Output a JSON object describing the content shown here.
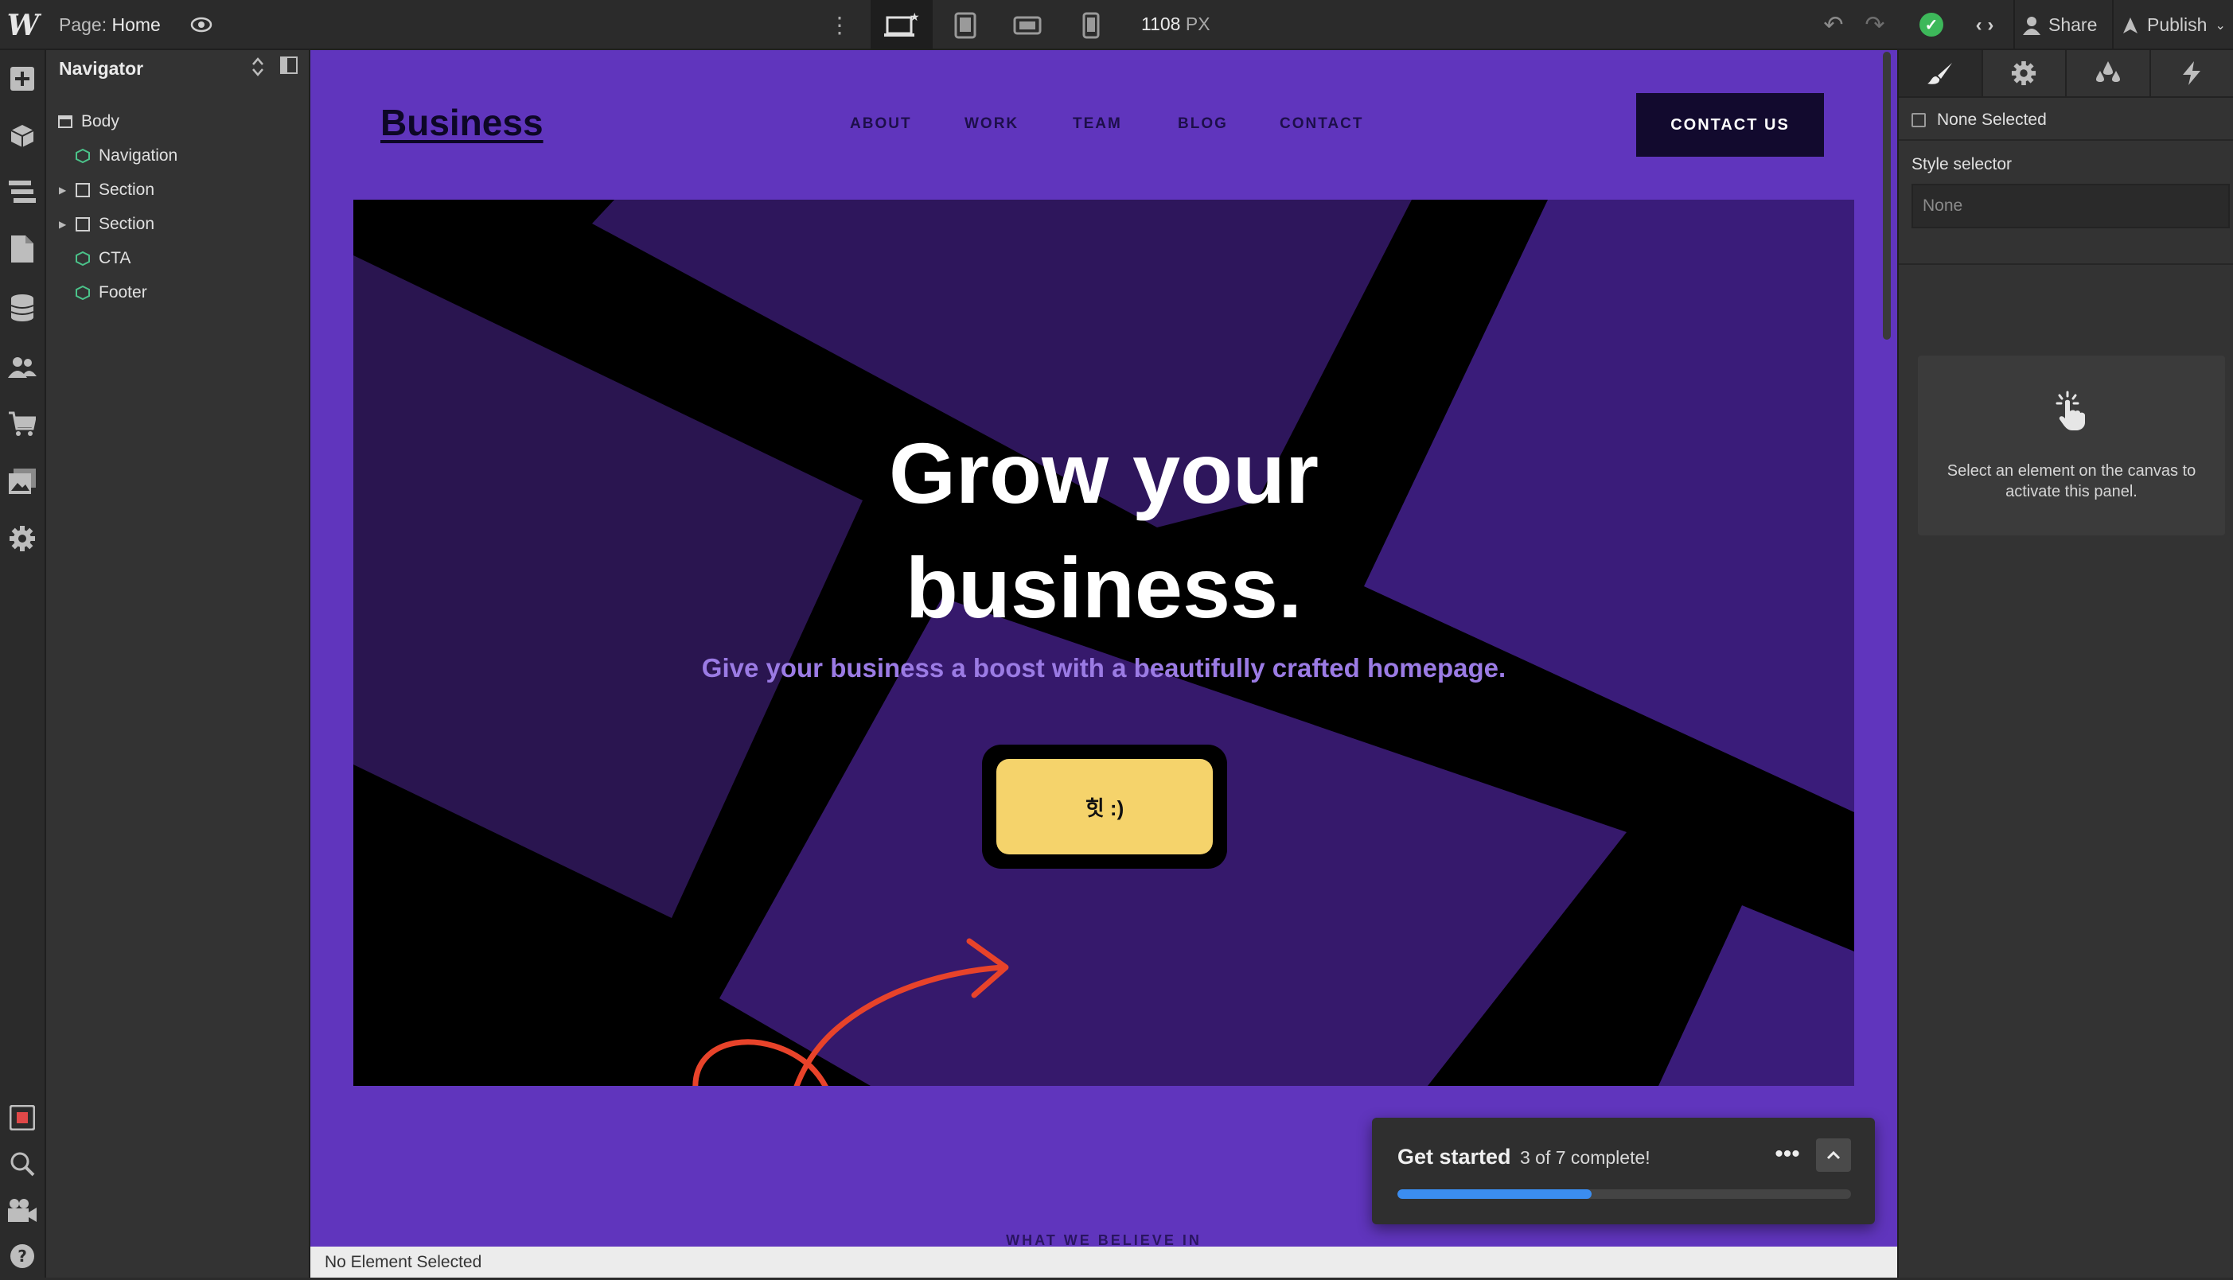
{
  "topbar": {
    "logo": "W",
    "page_prefix": "Page:",
    "page_name": "Home",
    "width_value": "1108",
    "width_unit": "PX",
    "share_label": "Share",
    "publish_label": "Publish"
  },
  "navigator": {
    "title": "Navigator",
    "items": [
      {
        "label": "Body",
        "icon": "body-icon",
        "expandable": false
      },
      {
        "label": "Navigation",
        "icon": "component-icon",
        "expandable": false
      },
      {
        "label": "Section",
        "icon": "section-icon",
        "expandable": true
      },
      {
        "label": "Section",
        "icon": "section-icon",
        "expandable": true
      },
      {
        "label": "CTA",
        "icon": "component-icon",
        "expandable": false
      },
      {
        "label": "Footer",
        "icon": "component-icon",
        "expandable": false
      }
    ]
  },
  "site": {
    "brand": "Business",
    "nav": [
      "ABOUT",
      "WORK",
      "TEAM",
      "BLOG",
      "CONTACT"
    ],
    "cta": "CONTACT US",
    "hero_title_1": "Grow your",
    "hero_title_2": "business.",
    "hero_subtitle": "Give your business a boost with a beautifully crafted homepage.",
    "hero_button": "힛 :)",
    "next_section_label": "WHAT WE BELIEVE IN"
  },
  "get_started": {
    "title": "Get started",
    "progress_text": "3 of 7 complete!",
    "completed": 3,
    "total": 7
  },
  "status_bar": "No Element Selected",
  "right_panel": {
    "selection": "None Selected",
    "style_selector_label": "Style selector",
    "style_selector_value": "None",
    "hint": "Select an element on the canvas to activate this panel."
  },
  "colors": {
    "canvas_bg": "#6035bd",
    "hero_bg": "#000000",
    "button_yellow": "#f5d36b",
    "arrow_red": "#e8432a",
    "progress_blue": "#3b8df0",
    "success_green": "#3db85a"
  }
}
